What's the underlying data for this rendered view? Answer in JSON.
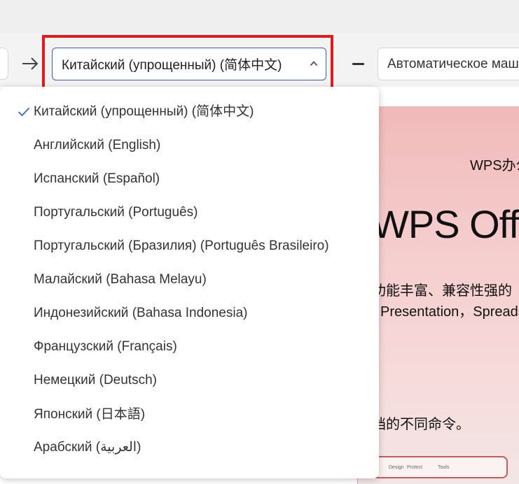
{
  "toolbar": {
    "target_language": "Китайский (упрощенный) (简体中文)",
    "mode_label": "Автоматическое машинное"
  },
  "language_dropdown": {
    "selected_index": 0,
    "options": [
      "Китайский (упрощенный) (简体中文)",
      "Английский (English)",
      "Испанский (Español)",
      "Португальский (Português)",
      "Португальский (Бразилия) (Português Brasileiro)",
      "Малайский (Bahasa Melayu)",
      "Индонезийский (Bahasa Indonesia)",
      "Французский (Français)",
      "Немецкий (Deutsch)",
      "Японский (日本語)",
      "Арабский (العربية)"
    ]
  },
  "slide": {
    "subtitle": "WPS办公套件",
    "title": "WPS Office",
    "line_cn": "功能丰富、兼容性强的",
    "line_en": "Presentation，Spreadsheet",
    "line_cn2": "档的不同命令。",
    "ribbon_tabs": [
      "Design",
      "Protect",
      "Tools"
    ]
  },
  "colors": {
    "highlight": "#e01b1b",
    "select_border": "#3a5fd0",
    "check": "#3a5fd0"
  },
  "icons": [
    "arrow-right-icon",
    "chevron-up-icon",
    "minus-icon",
    "check-icon"
  ]
}
